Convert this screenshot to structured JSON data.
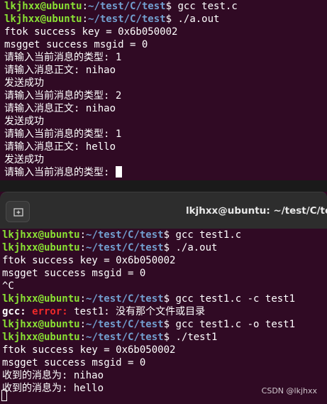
{
  "top_terminal": {
    "prompt": {
      "user": "lkjhxx@ubuntu",
      "sep": ":",
      "path": "~/test/C/test",
      "dollar": "$"
    },
    "lines": [
      {
        "kind": "prompt",
        "cmd": " gcc test.c"
      },
      {
        "kind": "prompt",
        "cmd": " ./a.out"
      },
      {
        "kind": "text",
        "text": "ftok success key = 0x6b050002"
      },
      {
        "kind": "text",
        "text": "msgget success msgid = 0"
      },
      {
        "kind": "text",
        "text": "请输入当前消息的类型: 1"
      },
      {
        "kind": "text",
        "text": "请输入消息正文: nihao"
      },
      {
        "kind": "text",
        "text": "发送成功"
      },
      {
        "kind": "text",
        "text": "请输入当前消息的类型: 2"
      },
      {
        "kind": "text",
        "text": "请输入消息正文: nihao"
      },
      {
        "kind": "text",
        "text": "发送成功"
      },
      {
        "kind": "text",
        "text": "请输入当前消息的类型: 1"
      },
      {
        "kind": "text",
        "text": "请输入消息正文: hello"
      },
      {
        "kind": "text",
        "text": "发送成功"
      },
      {
        "kind": "text",
        "text": "请输入当前消息的类型: "
      }
    ]
  },
  "titlebar": {
    "title": "lkjhxx@ubuntu: ~/test/C/test",
    "new_tab_icon": "new-tab-icon"
  },
  "bottom_terminal": {
    "prompt": {
      "user": "lkjhxx@ubuntu",
      "sep": ":",
      "path": "~/test/C/test",
      "dollar": "$"
    },
    "lines": [
      {
        "kind": "prompt",
        "cmd": " gcc test1.c"
      },
      {
        "kind": "prompt",
        "cmd": " ./a.out"
      },
      {
        "kind": "text",
        "text": "ftok success key = 0x6b050002"
      },
      {
        "kind": "text",
        "text": "msgget success msgid = 0"
      },
      {
        "kind": "text",
        "text": "^C"
      },
      {
        "kind": "prompt",
        "cmd": " gcc test1.c -c test1"
      },
      {
        "kind": "error",
        "label": "gcc:",
        "word": " error:",
        "text": " test1: 没有那个文件或目录"
      },
      {
        "kind": "prompt",
        "cmd": " gcc test1.c -o test1"
      },
      {
        "kind": "prompt",
        "cmd": " ./test1"
      },
      {
        "kind": "text",
        "text": "ftok success key = 0x6b050002"
      },
      {
        "kind": "text",
        "text": "msgget success msgid = 0"
      },
      {
        "kind": "text",
        "text": "收到的消息为: nihao"
      },
      {
        "kind": "text",
        "text": "收到的消息为: hello"
      }
    ]
  },
  "watermark": "CSDN @lkjhxx",
  "colors": {
    "background": "#300a24",
    "user": "#8ae234",
    "path": "#729fcf",
    "error": "#ef2929",
    "titlebar": "#2d2d2d"
  }
}
